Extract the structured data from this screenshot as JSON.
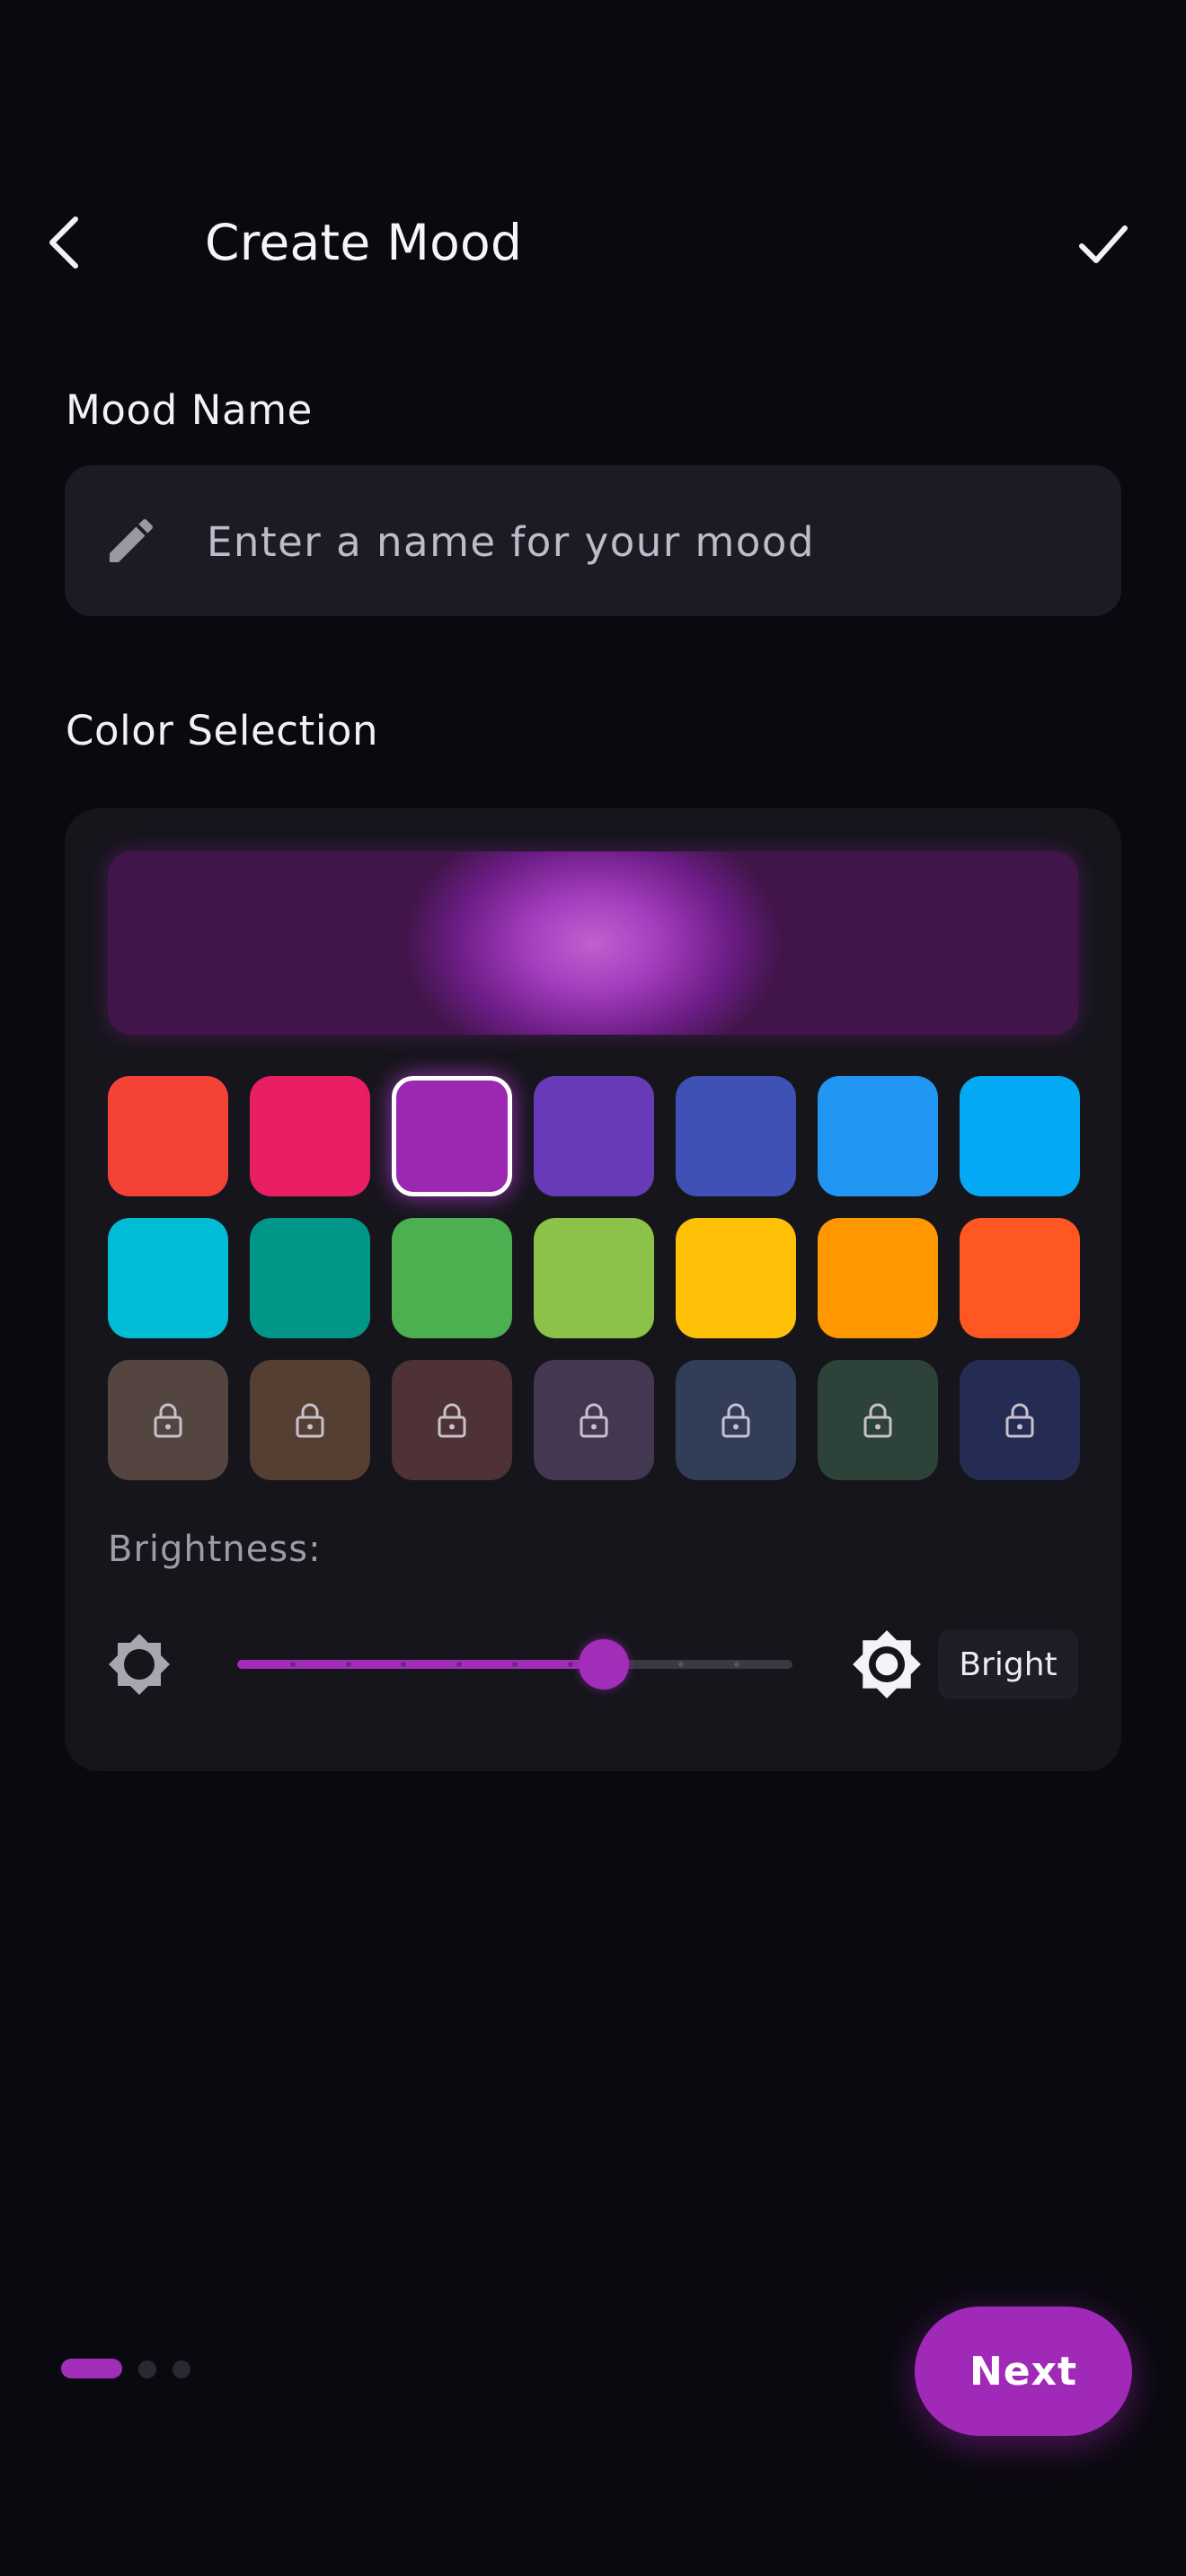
{
  "header": {
    "title": "Create Mood"
  },
  "mood_name": {
    "label": "Mood Name",
    "placeholder": "Enter a name for your mood",
    "value": ""
  },
  "color_selection": {
    "label": "Color Selection",
    "selected_color": "#9C27B0",
    "preview_color": "#9C27B0",
    "swatches": [
      {
        "color": "#F44336",
        "locked": false
      },
      {
        "color": "#E91E63",
        "locked": false
      },
      {
        "color": "#9C27B0",
        "locked": false,
        "selected": true
      },
      {
        "color": "#673AB7",
        "locked": false
      },
      {
        "color": "#3F51B5",
        "locked": false
      },
      {
        "color": "#2196F3",
        "locked": false
      },
      {
        "color": "#03A9F4",
        "locked": false
      },
      {
        "color": "#00BCD4",
        "locked": false
      },
      {
        "color": "#009688",
        "locked": false
      },
      {
        "color": "#4CAF50",
        "locked": false
      },
      {
        "color": "#8BC34A",
        "locked": false
      },
      {
        "color": "#FFC107",
        "locked": false
      },
      {
        "color": "#FF9800",
        "locked": false
      },
      {
        "color": "#FF5722",
        "locked": false
      },
      {
        "color": "#544541",
        "locked": true
      },
      {
        "color": "#553e32",
        "locked": true
      },
      {
        "color": "#4e3236",
        "locked": true
      },
      {
        "color": "#433752",
        "locked": true
      },
      {
        "color": "#323d58",
        "locked": true
      },
      {
        "color": "#2d4339",
        "locked": true
      },
      {
        "color": "#252c54",
        "locked": true
      }
    ]
  },
  "brightness": {
    "label": "Brightness:",
    "value_percent": 66,
    "steps": 10,
    "level_label": "Bright"
  },
  "pager": {
    "total": 3,
    "current": 1
  },
  "next_button": {
    "label": "Next"
  },
  "colors": {
    "background": "#0a0910",
    "accent": "#a129b8",
    "card": "#16151c"
  }
}
